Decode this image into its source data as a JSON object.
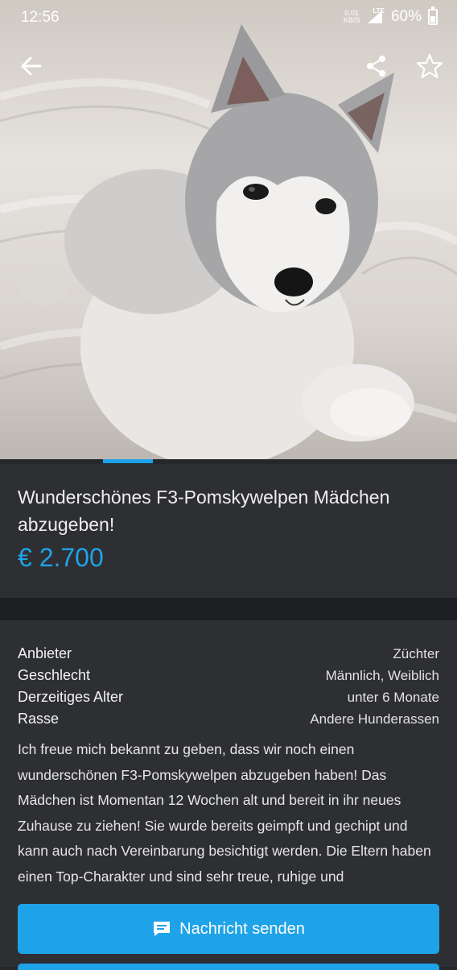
{
  "status_bar": {
    "time": "12:56",
    "network_speed": "0.01",
    "network_unit": "KB/S",
    "network_type": "LTE",
    "battery_percent": "60%",
    "battery_level": 0.6
  },
  "header": {
    "back_icon": "arrow-left-icon",
    "share_icon": "share-icon",
    "favorite_icon": "star-outline-icon"
  },
  "gallery": {
    "image_subject": "puppy-photo",
    "active_page": 2
  },
  "listing": {
    "title": "Wunderschönes F3-Pomskywelpen Mädchen abzugeben!",
    "price": "€ 2.700"
  },
  "attributes": [
    {
      "label": "Anbieter",
      "value": "Züchter"
    },
    {
      "label": "Geschlecht",
      "value": "Männlich, Weiblich"
    },
    {
      "label": "Derzeitiges Alter",
      "value": "unter 6 Monate"
    },
    {
      "label": "Rasse",
      "value": "Andere Hunderassen"
    }
  ],
  "description": "Ich freue mich bekannt zu geben, dass wir noch einen wunderschönen F3-Pomskywelpen abzugeben haben! Das Mädchen ist Momentan 12 Wochen alt und bereit in ihr neues Zuhause zu ziehen! Sie wurde bereits geimpft und gechipt und kann auch nach Vereinbarung besichtigt werden. Die Eltern haben einen Top-Charakter und sind sehr treue, ruhige und",
  "actions": {
    "send_message_label": "Nachricht senden",
    "send_message_icon": "chat-icon"
  },
  "colors": {
    "accent": "#1fa3e8",
    "background": "#26272b",
    "card": "#2e2f33"
  }
}
